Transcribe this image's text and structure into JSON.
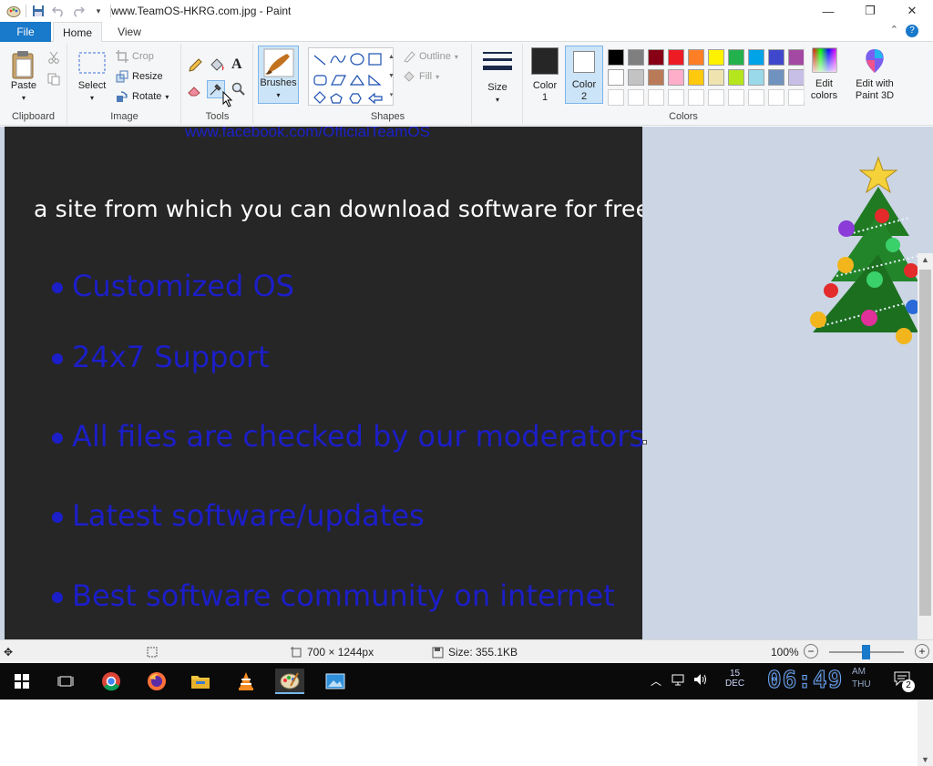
{
  "window": {
    "title": "www.TeamOS-HKRG.com.jpg - Paint",
    "minimize": "—",
    "maximize": "❐",
    "close": "✕"
  },
  "tabs": {
    "file": "File",
    "home": "Home",
    "view": "View",
    "help": "?",
    "collapse": "⌃"
  },
  "ribbon": {
    "clipboard": {
      "label": "Clipboard",
      "paste": "Paste"
    },
    "image": {
      "label": "Image",
      "select": "Select",
      "crop": "Crop",
      "resize": "Resize",
      "rotate": "Rotate"
    },
    "tools": {
      "label": "Tools"
    },
    "brushes": {
      "label": "Brushes"
    },
    "shapes": {
      "label": "Shapes",
      "outline": "Outline",
      "fill": "Fill"
    },
    "size": {
      "label": "Size"
    },
    "color1": {
      "label": "Color",
      "num": "1",
      "value": "#262626"
    },
    "color2": {
      "label": "Color",
      "num": "2",
      "value": "#ffffff"
    },
    "colors": {
      "label": "Colors",
      "row1": [
        "#000000",
        "#7f7f7f",
        "#880015",
        "#ed1c24",
        "#ff7f27",
        "#fff200",
        "#22b14c",
        "#00a2e8",
        "#3f48cc",
        "#a349a4"
      ],
      "row2": [
        "#ffffff",
        "#c3c3c3",
        "#b97a57",
        "#ffaec9",
        "#ffc90e",
        "#efe4b0",
        "#b5e61d",
        "#99d9ea",
        "#7092be",
        "#c8bfe7"
      ],
      "row3": [
        "#ffffff",
        "#ffffff",
        "#ffffff",
        "#ffffff",
        "#ffffff",
        "#ffffff",
        "#ffffff",
        "#ffffff",
        "#ffffff",
        "#ffffff"
      ]
    },
    "edit_colors": {
      "line1": "Edit",
      "line2": "colors"
    },
    "paint3d": {
      "line1": "Edit with",
      "line2": "Paint 3D"
    }
  },
  "canvas": {
    "url_text": "www.facebook.com/OfficialTeamOS",
    "heading": "a site from which you can download software for free:",
    "bullets": [
      "Customized OS",
      "24x7 Support",
      "All files are checked by our moderators",
      "Latest software/updates",
      "Best software community on internet"
    ]
  },
  "status": {
    "dimensions": "700 × 1244px",
    "size": "Size: 355.1KB",
    "zoom": "100%"
  },
  "taskbar": {
    "clock": "06:49",
    "ampm": "AM",
    "day": "THU",
    "date_day": "15",
    "date_month": "DEC",
    "notif_count": "2"
  }
}
